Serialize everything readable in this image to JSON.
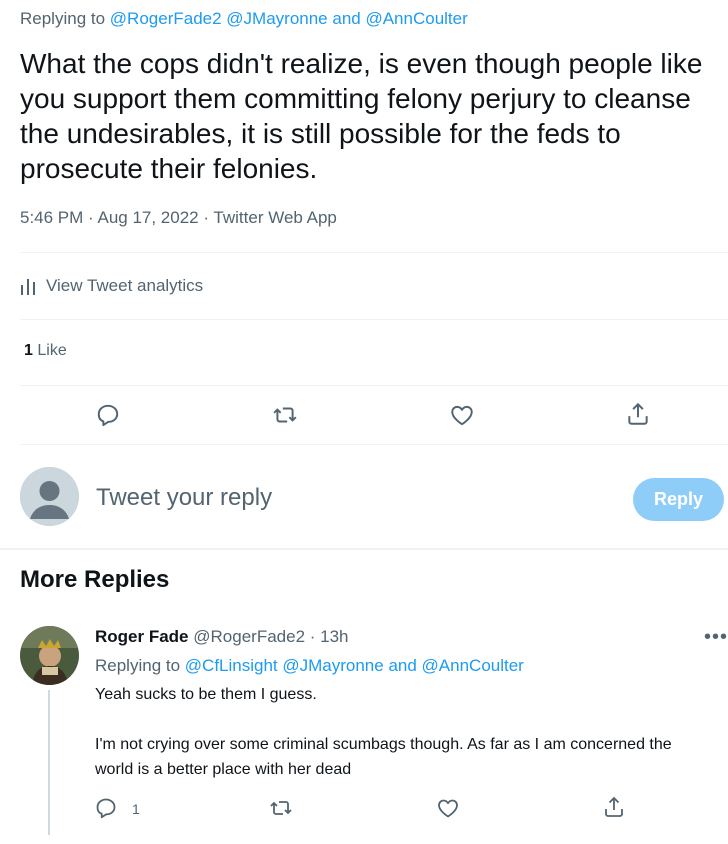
{
  "tweet": {
    "replying_prefix": "Replying to",
    "replying_mentions": "@RogerFade2 @JMayronne",
    "replying_and": " and ",
    "replying_last": "@AnnCoulter",
    "text": "What the cops didn't realize, is even though people like you support them committing felony perjury to cleanse the undesirables, it is still possible for the feds to prosecute their felonies.",
    "meta": "5:46 PM · Aug 17, 2022 · Twitter Web App",
    "analytics_label": "View Tweet analytics",
    "like_count": "1",
    "like_label": "Like"
  },
  "compose": {
    "placeholder": "Tweet your reply",
    "button_label": "Reply"
  },
  "more_replies": {
    "title": "More Replies",
    "reply": {
      "name": "Roger Fade",
      "handle": "@RogerFade2",
      "time": " · 13h",
      "replying_prefix": "Replying to ",
      "replying_mentions": "@CfLinsight @JMayronne",
      "replying_and": " and ",
      "replying_last": "@AnnCoulter",
      "line1": "Yeah sucks to be them I guess.",
      "line2": "I'm not crying over some criminal scumbags though. As far as I am concerned the world is a better place with her dead",
      "reply_count": "1"
    }
  },
  "colors": {
    "accent": "#1d9bf0",
    "muted": "#536471",
    "reply_button_disabled": "#8ecdf7"
  },
  "icons": [
    "reply-icon",
    "retweet-icon",
    "like-icon",
    "share-icon",
    "analytics-icon",
    "more-icon",
    "avatar-placeholder-icon"
  ]
}
